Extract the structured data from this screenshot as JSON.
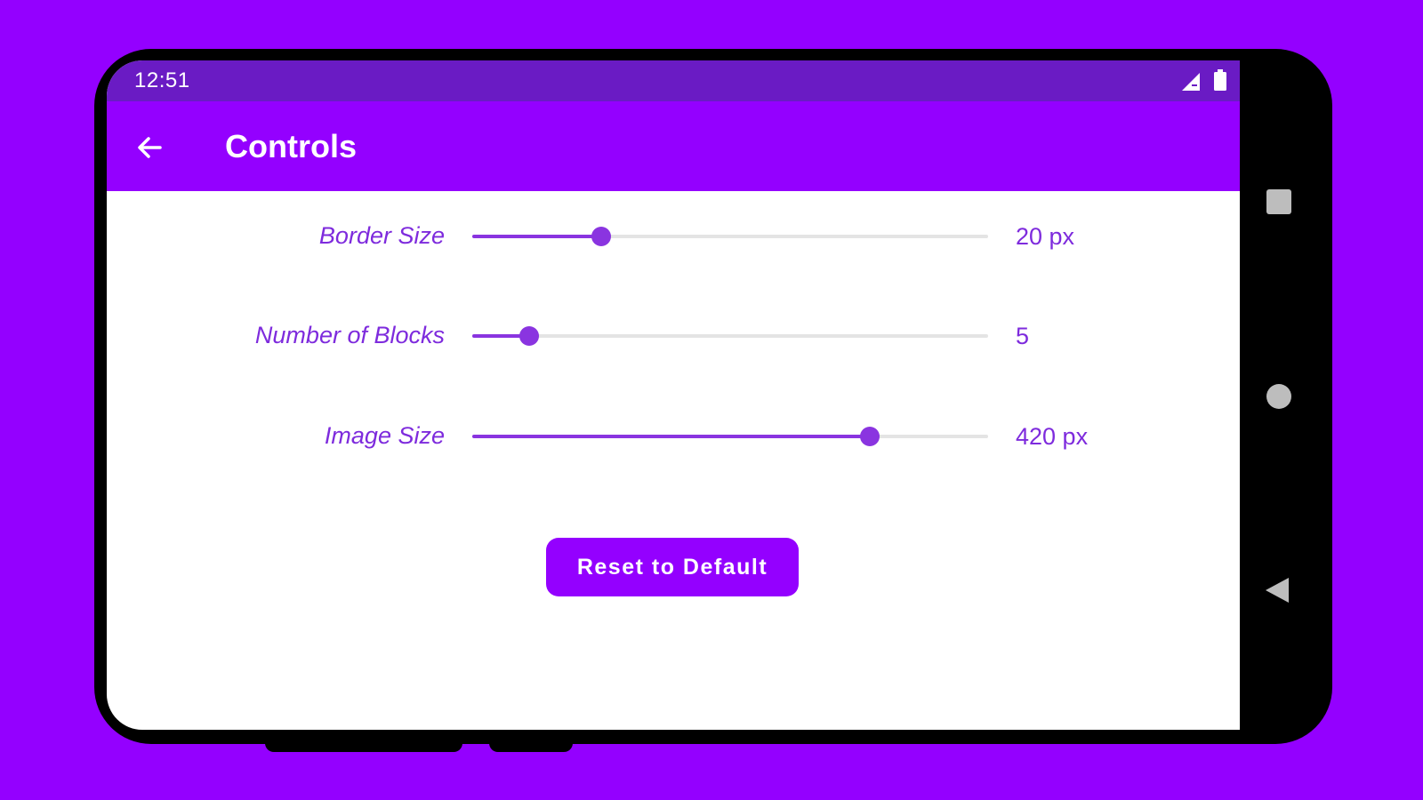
{
  "status_bar": {
    "time": "12:51",
    "icons": [
      "signal-icon",
      "battery-icon"
    ]
  },
  "app_bar": {
    "title": "Controls",
    "back_icon": "arrow-left-icon"
  },
  "controls": [
    {
      "label": "Border Size",
      "value_text": "20 px",
      "slider_fraction": 0.25
    },
    {
      "label": "Number of Blocks",
      "value_text": "5",
      "slider_fraction": 0.11
    },
    {
      "label": "Image Size",
      "value_text": "420 px",
      "slider_fraction": 0.77
    }
  ],
  "reset_button": {
    "label": "Reset to Default"
  },
  "navigation_bar": {
    "icons": [
      "recents-square-icon",
      "home-circle-icon",
      "back-triangle-icon"
    ]
  },
  "colors": {
    "background": "#9400ff",
    "status_bar": "#6a1bc4",
    "app_bar": "#9400ff",
    "accent": "#8a34e0",
    "label_text": "#7e2bdd",
    "track_inactive": "#e4e4e4"
  }
}
